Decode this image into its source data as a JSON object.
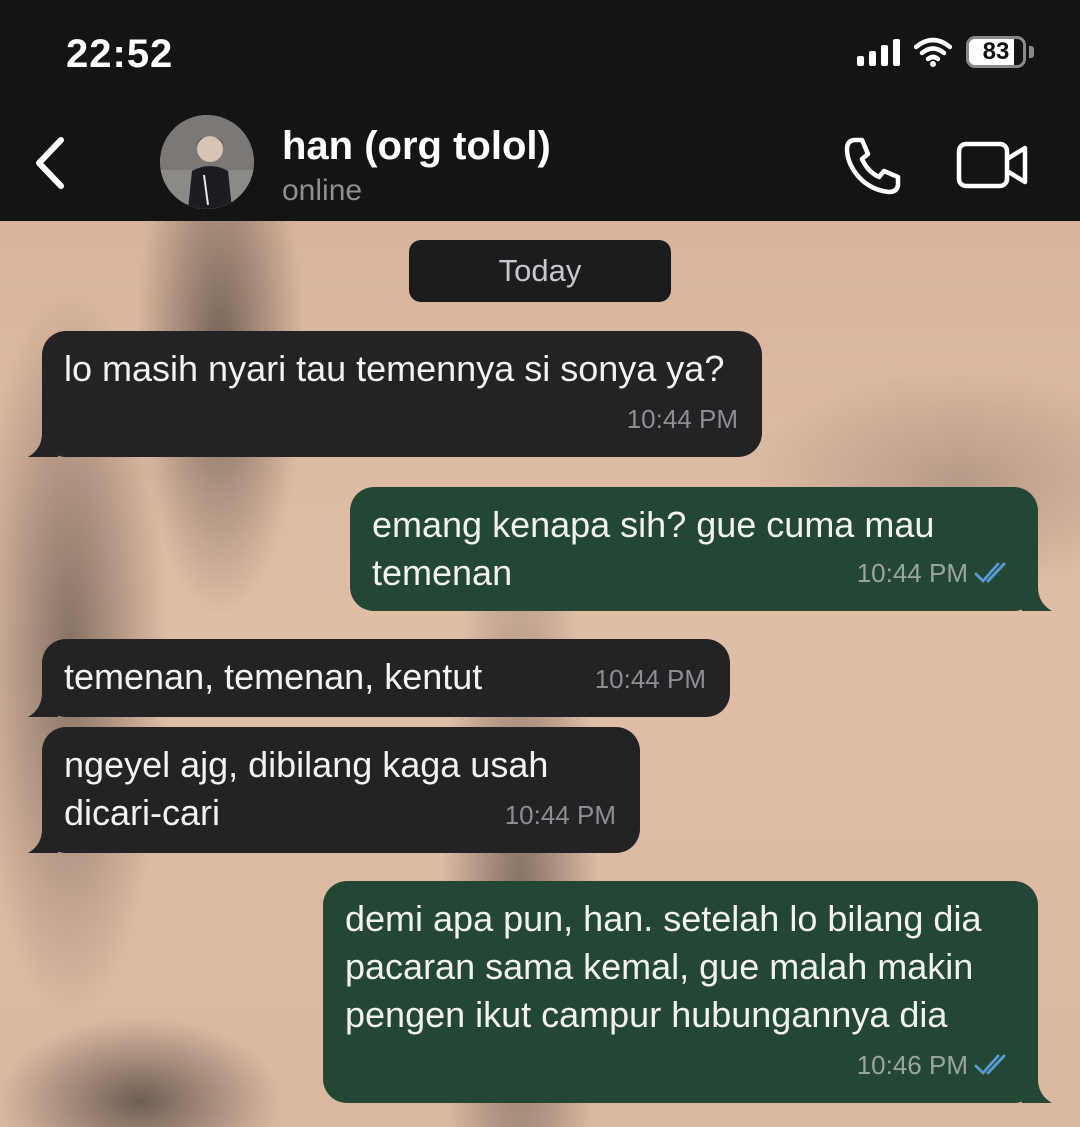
{
  "status_bar": {
    "time": "22:52",
    "battery": "83",
    "battery_level": 0.83,
    "icons": [
      "cellular-signal-icon",
      "wifi-icon",
      "battery-icon"
    ]
  },
  "header": {
    "back_icon": "chevron-left-icon",
    "contact_name": "han (org tolol)",
    "contact_status": "online",
    "call_icon": "phone-icon",
    "video_icon": "video-camera-icon"
  },
  "chat": {
    "date_label": "Today",
    "messages": [
      {
        "direction": "in",
        "text": "lo masih nyari tau temennya si sonya ya?",
        "time": "10:44 PM"
      },
      {
        "direction": "out",
        "text": "emang kenapa sih? gue cuma mau temenan",
        "time": "10:44 PM",
        "read": true
      },
      {
        "direction": "in",
        "text": "temenan, temenan, kentut",
        "time": "10:44 PM"
      },
      {
        "direction": "in",
        "text": "ngeyel ajg, dibilang kaga usah dicari-cari",
        "time": "10:44 PM"
      },
      {
        "direction": "out",
        "text": "demi apa pun, han. setelah lo bilang dia pacaran sama kemal, gue malah makin pengen ikut campur hubungannya dia",
        "time": "10:46 PM",
        "read": true
      }
    ]
  },
  "colors": {
    "header_bg": "#141414",
    "incoming_bubble": "#232325",
    "outgoing_bubble": "#244634",
    "read_ticks": "#5b9bd5"
  }
}
